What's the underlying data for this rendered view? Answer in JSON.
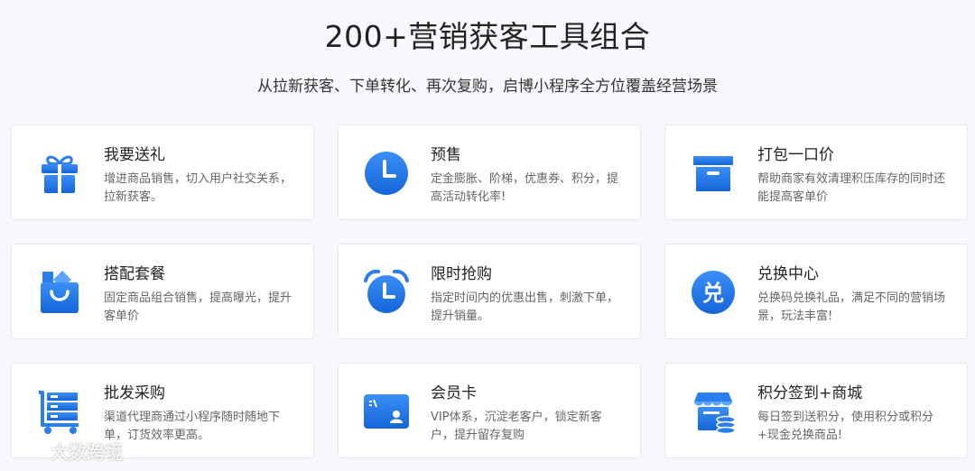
{
  "header": {
    "title": "200+营销获客工具组合",
    "subtitle": "从拉新获客、下单转化、再次复购，启博小程序全方位覆盖经营场景"
  },
  "cards": [
    {
      "title": "我要送礼",
      "desc": "增进商品销售，切入用户社交关系，拉新获客。",
      "icon": "gift-icon"
    },
    {
      "title": "预售",
      "desc": "定金膨胀、阶梯，优惠券、积分，提高活动转化率!",
      "icon": "clock-icon"
    },
    {
      "title": "打包一口价",
      "desc": "帮助商家有效清理积压库存的同时还能提高客单价",
      "icon": "box-icon"
    },
    {
      "title": "搭配套餐",
      "desc": "固定商品组合销售，提高曝光，提升客单价",
      "icon": "shopping-bag-icon"
    },
    {
      "title": "限时抢购",
      "desc": "指定时间内的优惠出售，刺激下单，提升销量。",
      "icon": "alarm-clock-icon"
    },
    {
      "title": "兑换中心",
      "desc": "兑换码兑换礼品，满足不同的营销场景，玩法丰富!",
      "icon": "exchange-icon"
    },
    {
      "title": "批发采购",
      "desc": "渠道代理商通过小程序随时随地下单，订货效率更高。",
      "icon": "cart-icon"
    },
    {
      "title": "会员卡",
      "desc": "VIP体系，沉淀老客户，锁定新客户，提升留存复购",
      "icon": "member-card-icon"
    },
    {
      "title": "积分签到+商城",
      "desc": "每日签到送积分，使用积分或积分+现金兑换商品!",
      "icon": "store-coins-icon"
    }
  ],
  "watermark": {
    "text": "大数跨境"
  },
  "colors": {
    "accent": "#2a7ef0",
    "accent_dark": "#1565d8",
    "background": "#f6f8fc"
  }
}
